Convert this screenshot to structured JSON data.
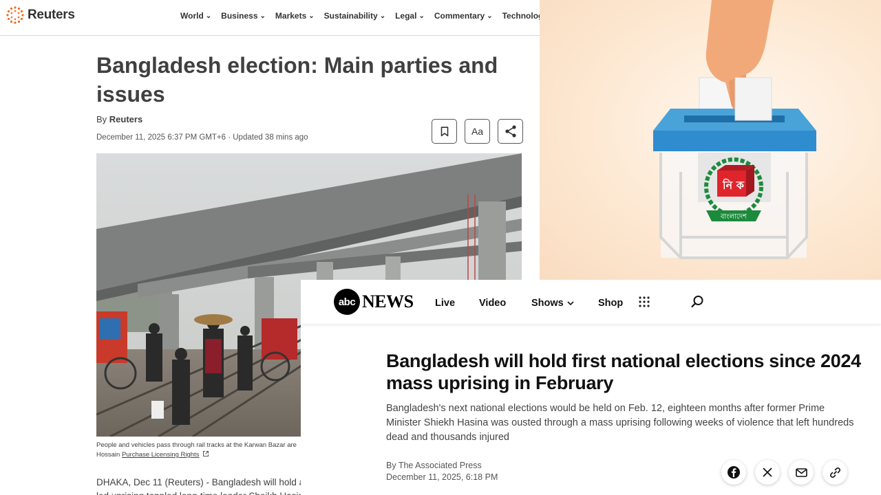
{
  "reuters": {
    "logo_text": "Reuters",
    "nav": [
      "World",
      "Business",
      "Markets",
      "Sustainability",
      "Legal",
      "Commentary",
      "Technology"
    ],
    "headline": "Bangladesh election: Main parties and issues",
    "byline_prefix": "By",
    "byline_author": "Reuters",
    "dateline": "December 11, 2025 6:37 PM GMT+6 · Updated 38 mins ago",
    "font_button_label": "Aa",
    "caption_line1": "People and vehicles pass through rail tracks at the Karwan Bazar are",
    "caption_line2_prefix": "Hossain",
    "caption_link": "Purchase Licensing Rights",
    "body_prefix": "DHAKA, Dec 11 (Reuters) - Bangladesh will hold a",
    "body_link": "n",
    "body_line2": "led uprising toppled long-time leader Sheikh Hasin"
  },
  "illustration": {
    "emblem_text": "বাংলাদেশ",
    "emblem_letters": "নি ক",
    "colors": {
      "box_lid": "#4aa3d8",
      "emblem_green": "#1c8a3c",
      "emblem_red": "#e0242c"
    }
  },
  "abc": {
    "logo_abc": "abc",
    "logo_news": "NEWS",
    "nav": {
      "live": "Live",
      "video": "Video",
      "shows": "Shows",
      "shop": "Shop"
    },
    "headline": "Bangladesh will hold first national elections since 2024 mass uprising in February",
    "summary": "Bangladesh's next national elections would be held on Feb. 12, eighteen months after former Prime Minister Shiekh Hasina was ousted through a mass uprising following weeks of violence that left hundreds dead and thousands injured",
    "author": "By The Associated Press",
    "date": "December 11, 2025, 6:18 PM"
  }
}
